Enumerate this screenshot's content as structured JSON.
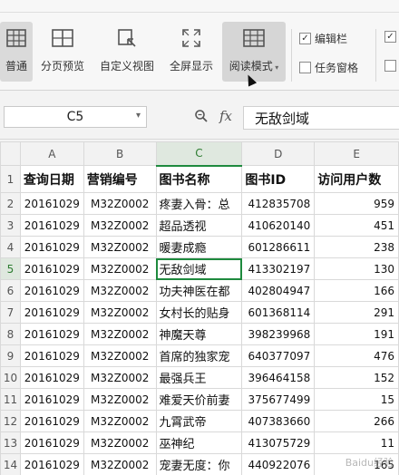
{
  "ribbon": {
    "buttons": [
      {
        "label": "普通",
        "icon": "normal-view-icon"
      },
      {
        "label": "分页预览",
        "icon": "page-break-icon"
      },
      {
        "label": "自定义视图",
        "icon": "custom-view-icon"
      },
      {
        "label": "全屏显示",
        "icon": "fullscreen-icon"
      },
      {
        "label": "阅读模式",
        "icon": "reading-mode-icon"
      }
    ],
    "checks": [
      {
        "label": "编辑栏",
        "checked": true
      },
      {
        "label": "任务窗格",
        "checked": false
      }
    ]
  },
  "formula_bar": {
    "cell_ref": "C5",
    "fx": "fx",
    "content": "无敌剑域"
  },
  "sheet": {
    "columns": [
      "A",
      "B",
      "C",
      "D",
      "E"
    ],
    "header_row": [
      "查询日期",
      "营销编号",
      "图书名称",
      "图书ID",
      "访问用户数"
    ],
    "rows": [
      {
        "n": "2",
        "a": "20161029",
        "b": "M32Z0002",
        "c": "疼妻入骨：总",
        "d": "412835708",
        "e": "959"
      },
      {
        "n": "3",
        "a": "20161029",
        "b": "M32Z0002",
        "c": "超品透视",
        "d": "410620140",
        "e": "451"
      },
      {
        "n": "4",
        "a": "20161029",
        "b": "M32Z0002",
        "c": "暖妻成瘾",
        "d": "601286611",
        "e": "238"
      },
      {
        "n": "5",
        "a": "20161029",
        "b": "M32Z0002",
        "c": "无敌剑域",
        "d": "413302197",
        "e": "130"
      },
      {
        "n": "6",
        "a": "20161029",
        "b": "M32Z0002",
        "c": "功夫神医在都",
        "d": "402804947",
        "e": "166"
      },
      {
        "n": "7",
        "a": "20161029",
        "b": "M32Z0002",
        "c": "女村长的贴身",
        "d": "601368114",
        "e": "291"
      },
      {
        "n": "8",
        "a": "20161029",
        "b": "M32Z0002",
        "c": "神魔天尊",
        "d": "398239968",
        "e": "191"
      },
      {
        "n": "9",
        "a": "20161029",
        "b": "M32Z0002",
        "c": "首席的独家宠",
        "d": "640377097",
        "e": "476"
      },
      {
        "n": "10",
        "a": "20161029",
        "b": "M32Z0002",
        "c": "最强兵王",
        "d": "396464158",
        "e": "152"
      },
      {
        "n": "11",
        "a": "20161029",
        "b": "M32Z0002",
        "c": "难爱天价前妻",
        "d": "375677499",
        "e": "15"
      },
      {
        "n": "12",
        "a": "20161029",
        "b": "M32Z0002",
        "c": "九霄武帝",
        "d": "407383660",
        "e": "266"
      },
      {
        "n": "13",
        "a": "20161029",
        "b": "M32Z0002",
        "c": "巫神纪",
        "d": "413075729",
        "e": "11"
      },
      {
        "n": "14",
        "a": "20161029",
        "b": "M32Z0002",
        "c": "宠妻无度：你",
        "d": "440922076",
        "e": "165"
      }
    ]
  },
  "watermark": "Baidu经验"
}
